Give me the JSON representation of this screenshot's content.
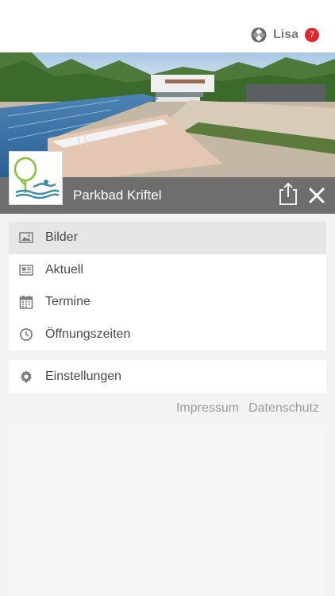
{
  "header": {
    "user_name": "Lisa",
    "notification_count": "7"
  },
  "venue": {
    "title": "Parkbad Kriftel"
  },
  "menu": {
    "items": [
      {
        "label": "Bilder",
        "icon": "image-icon",
        "active": true
      },
      {
        "label": "Aktuell",
        "icon": "newspaper-icon",
        "active": false
      },
      {
        "label": "Termine",
        "icon": "calendar-icon",
        "active": false
      },
      {
        "label": "Öffnungszeiten",
        "icon": "clock-icon",
        "active": false
      }
    ],
    "settings_label": "Einstellungen",
    "settings_icon": "gear-icon"
  },
  "footer": {
    "impressum_label": "Impressum",
    "datenschutz_label": "Datenschutz"
  },
  "colors": {
    "titlebar": "#6e6e6e",
    "badge": "#e0262b",
    "active_item": "#e6e6e6",
    "background": "#f3f3f3"
  }
}
